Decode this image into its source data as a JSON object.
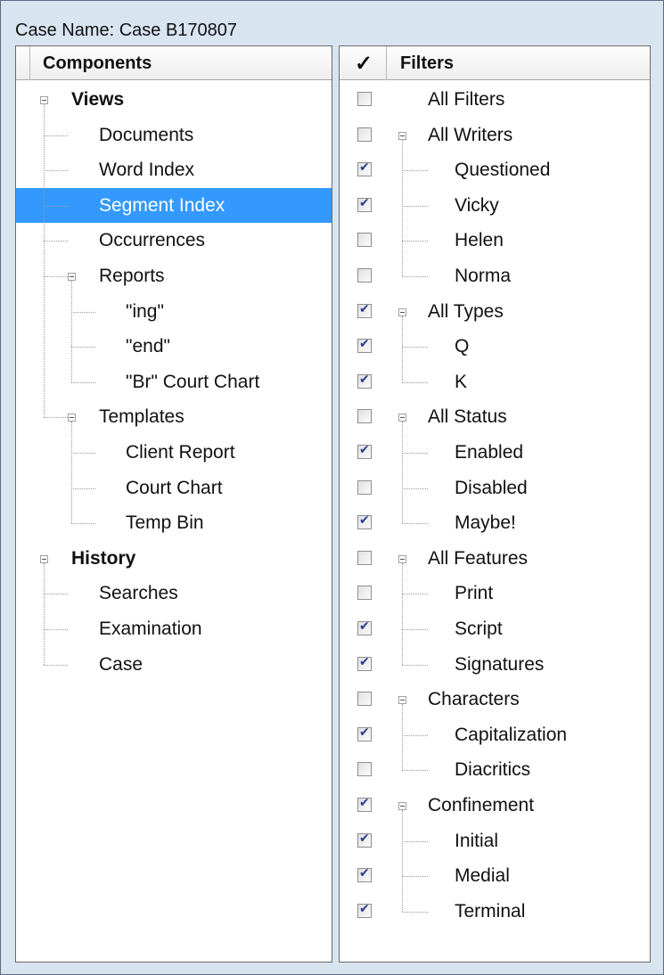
{
  "window": {
    "case_name": "Case Name: Case B170807"
  },
  "components": {
    "header": "Components",
    "items": [
      {
        "label": "Views",
        "bold": true
      },
      {
        "label": "Documents"
      },
      {
        "label": "Word Index"
      },
      {
        "label": "Segment Index",
        "selected": true
      },
      {
        "label": "Occurrences"
      },
      {
        "label": "Reports"
      },
      {
        "label": "\"ing\""
      },
      {
        "label": "\"end\""
      },
      {
        "label": "\"Br\" Court Chart"
      },
      {
        "label": "Templates"
      },
      {
        "label": "Client Report"
      },
      {
        "label": "Court Chart"
      },
      {
        "label": "Temp Bin"
      },
      {
        "label": "History",
        "bold": true
      },
      {
        "label": "Searches"
      },
      {
        "label": "Examination"
      },
      {
        "label": "Case"
      }
    ]
  },
  "filters": {
    "header_check": "✓",
    "header": "Filters",
    "items": [
      {
        "label": "All Filters",
        "checked": false
      },
      {
        "label": "All Writers",
        "checked": false
      },
      {
        "label": "Questioned",
        "checked": true
      },
      {
        "label": "Vicky",
        "checked": true
      },
      {
        "label": "Helen",
        "checked": false
      },
      {
        "label": "Norma",
        "checked": false
      },
      {
        "label": "All Types",
        "checked": true
      },
      {
        "label": "Q",
        "checked": true
      },
      {
        "label": "K",
        "checked": true
      },
      {
        "label": "All Status",
        "checked": false
      },
      {
        "label": "Enabled",
        "checked": true
      },
      {
        "label": "Disabled",
        "checked": false
      },
      {
        "label": "Maybe!",
        "checked": true
      },
      {
        "label": "All Features",
        "checked": false
      },
      {
        "label": "Print",
        "checked": false
      },
      {
        "label": "Script",
        "checked": true
      },
      {
        "label": "Signatures",
        "checked": true
      },
      {
        "label": "Characters",
        "checked": false
      },
      {
        "label": "Capitalization",
        "checked": true
      },
      {
        "label": "Diacritics",
        "checked": false
      },
      {
        "label": "Confinement",
        "checked": true
      },
      {
        "label": "Initial",
        "checked": true
      },
      {
        "label": "Medial",
        "checked": true
      },
      {
        "label": "Terminal",
        "checked": true
      }
    ]
  }
}
